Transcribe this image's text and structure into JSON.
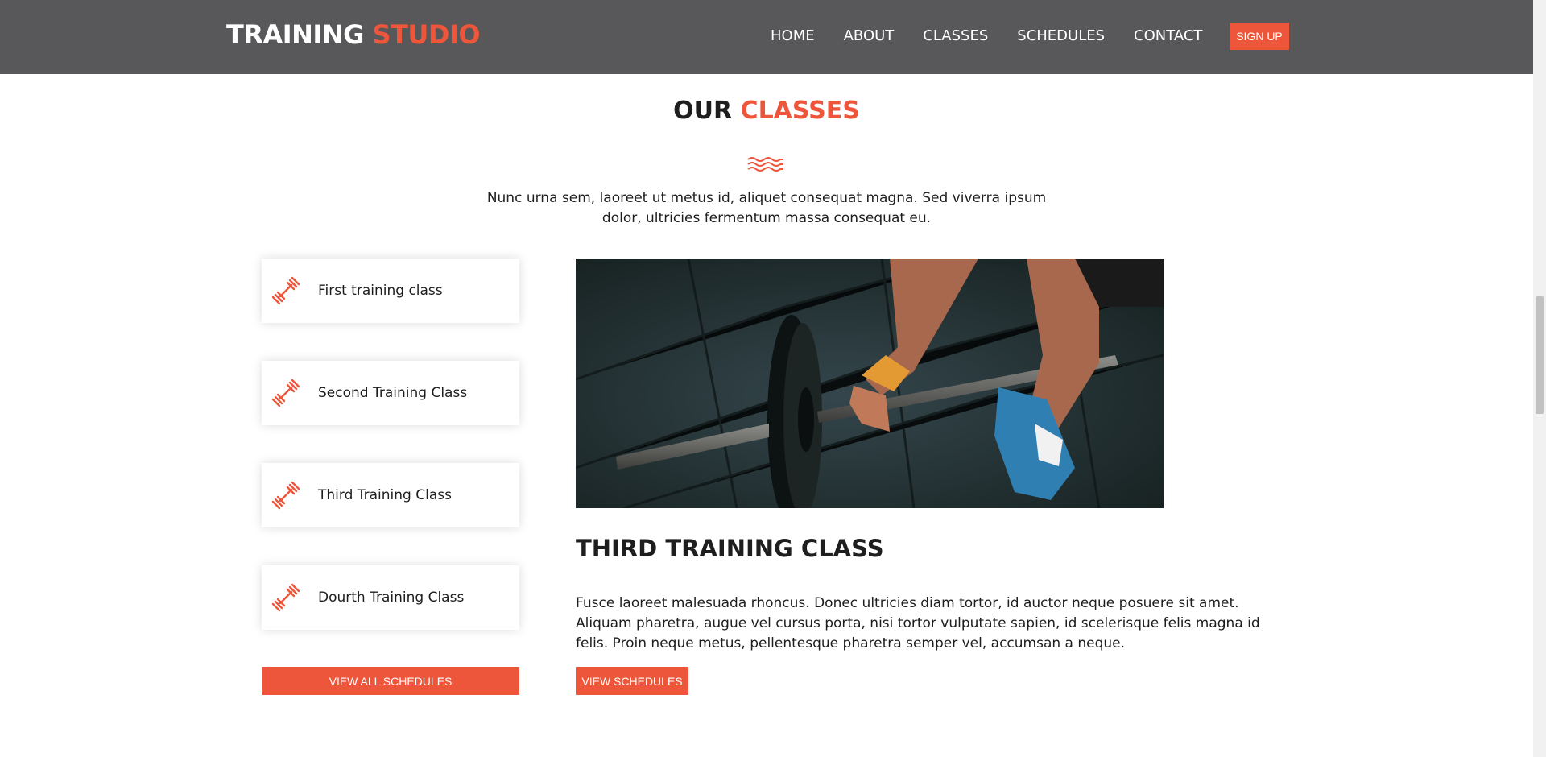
{
  "header": {
    "logo_main": "TRAINING",
    "logo_accent": "STUDIO",
    "nav": [
      "HOME",
      "ABOUT",
      "CLASSES",
      "SCHEDULES",
      "CONTACT"
    ],
    "signup_label": "SIGN UP"
  },
  "section": {
    "title_main": "OUR",
    "title_accent": "CLASSES",
    "intro": "Nunc urna sem, laoreet ut metus id, aliquet consequat magna. Sed viverra ipsum dolor, ultricies fermentum massa consequat eu."
  },
  "tabs": [
    {
      "label": "First training class",
      "icon": "dumbbell-icon"
    },
    {
      "label": "Second Training Class",
      "icon": "dumbbell-icon"
    },
    {
      "label": "Third Training Class",
      "icon": "dumbbell-icon"
    },
    {
      "label": "Dourth Training Class",
      "icon": "dumbbell-icon"
    }
  ],
  "view_all_label": "VIEW ALL SCHEDULES",
  "content": {
    "title": "THIRD TRAINING CLASS",
    "description": "Fusce laoreet malesuada rhoncus. Donec ultricies diam tortor, id auctor neque posuere sit amet. Aliquam pharetra, augue vel cursus porta, nisi tortor vulputate sapien, id scelerisque felis magna id felis. Proin neque metus, pellentesque pharetra semper vel, accumsan a neque.",
    "button_label": "VIEW SCHEDULES"
  },
  "colors": {
    "accent": "#ed563b",
    "header_bg": "#58575a"
  }
}
